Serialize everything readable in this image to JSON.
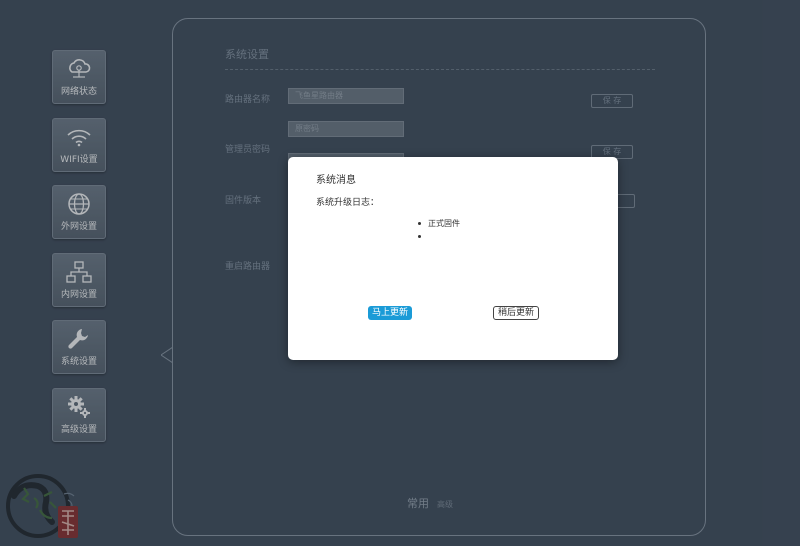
{
  "sidebar": {
    "items": [
      {
        "label": "网络状态",
        "icon": "cloud-network-icon"
      },
      {
        "label": "WIFI设置",
        "icon": "wifi-icon"
      },
      {
        "label": "外网设置",
        "icon": "globe-icon"
      },
      {
        "label": "内网设置",
        "icon": "lan-topology-icon"
      },
      {
        "label": "系统设置",
        "icon": "wrench-icon"
      },
      {
        "label": "高级设置",
        "icon": "gears-icon"
      }
    ],
    "active_index": 4
  },
  "settings": {
    "title": "系统设置",
    "router_name_label": "路由器名称",
    "router_name_value": "飞鱼星路由器",
    "admin_password_label": "管理员密码",
    "admin_password_placeholder": "原密码",
    "firmware_label": "固件版本",
    "reboot_label": "重启路由器",
    "save_label": "保 存",
    "save_label_2": "保 存"
  },
  "bottom_tabs": {
    "main": "常用",
    "sub": "高级"
  },
  "dialog": {
    "title": "系统消息",
    "log_label": "系统升级日志：",
    "log_items": [
      "正式固件",
      ""
    ],
    "update_now": "马上更新",
    "update_later": "稍后更新"
  },
  "colors": {
    "background": "#3d4a5a",
    "primary_button": "#1a9bd7",
    "tile": "#5f6b78"
  }
}
